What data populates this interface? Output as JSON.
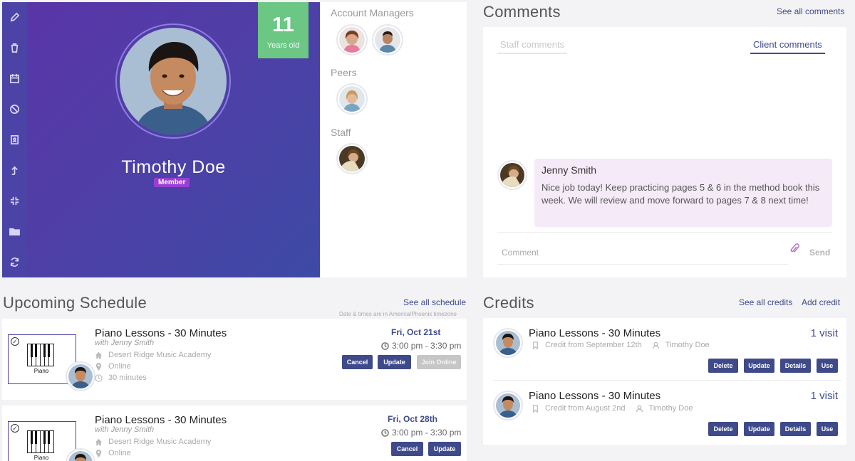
{
  "sidebar": {
    "icons": [
      "pencil-icon",
      "trash-icon",
      "calendar-icon",
      "ban-icon",
      "contact-book-icon",
      "arrow-up-icon",
      "compress-icon",
      "folder-icon",
      "refresh-icon"
    ]
  },
  "profile": {
    "name": "Timothy Doe",
    "badge": "Member",
    "age_number": "11",
    "age_label": "Years old"
  },
  "people": {
    "account_managers_label": "Account Managers",
    "peers_label": "Peers",
    "staff_label": "Staff"
  },
  "comments": {
    "title": "Comments",
    "see_all": "See all comments",
    "tabs": [
      {
        "label": "Staff comments",
        "active": false
      },
      {
        "label": "Client comments",
        "active": true
      }
    ],
    "items": [
      {
        "author": "Jenny Smith",
        "text": "Nice job today! Keep practicing pages 5 & 6 in the method book this week. We will review and move forward to pages 7 & 8 next time!"
      }
    ],
    "input_placeholder": "Comment",
    "send_label": "Send"
  },
  "schedule": {
    "title": "Upcoming Schedule",
    "see_all": "See all schedule",
    "timezone_note": "Date & times are in America/Phoenix timezone",
    "items": [
      {
        "thumb_label": "Piano",
        "title": "Piano Lessons - 30 Minutes",
        "with": "with Jenny Smith",
        "location": "Desert Ridge Music Academy",
        "mode": "Online",
        "duration": "30 minutes",
        "date": "Fri, Oct 21st",
        "time": "3:00 pm - 3:30 pm",
        "buttons": {
          "cancel": "Cancel",
          "update": "Update",
          "join": "Join Online"
        }
      },
      {
        "thumb_label": "Piano",
        "title": "Piano Lessons - 30 Minutes",
        "with": "with Jenny Smith",
        "location": "Desert Ridge Music Academy",
        "mode": "Online",
        "date": "Fri, Oct 28th",
        "time": "3:00 pm - 3:30 pm",
        "buttons": {
          "cancel": "Cancel",
          "update": "Update"
        }
      }
    ]
  },
  "credits": {
    "title": "Credits",
    "see_all": "See all credits",
    "add": "Add credit",
    "items": [
      {
        "title": "Piano Lessons - 30 Minutes",
        "visits": "1 visit",
        "source": "Credit from September 12th",
        "client": "Timothy Doe",
        "buttons": {
          "delete": "Delete",
          "update": "Update",
          "details": "Details",
          "use": "Use"
        }
      },
      {
        "title": "Piano Lessons - 30 Minutes",
        "visits": "1 visit",
        "source": "Credit from August 2nd",
        "client": "Timothy Doe",
        "buttons": {
          "delete": "Delete",
          "update": "Update",
          "details": "Details",
          "use": "Use"
        }
      }
    ]
  },
  "colors": {
    "accent": "#3f4a8a",
    "sidebar": "#4b44a6",
    "age_box": "#6cc784",
    "badge": "#9a3fd6",
    "comment_bubble": "#f4eaf8"
  }
}
